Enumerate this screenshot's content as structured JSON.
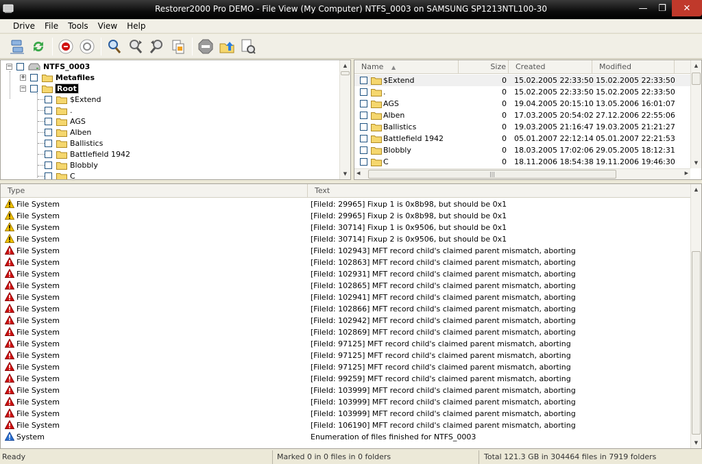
{
  "window": {
    "title": "Restorer2000 Pro DEMO - File View (My Computer) NTFS_0003 on SAMSUNG SP1213NTL100-30",
    "minimize_glyph": "—",
    "maximize_glyph": "❐",
    "close_glyph": "✕"
  },
  "menu": [
    "Drive",
    "File",
    "Tools",
    "View",
    "Help"
  ],
  "toolbar": {
    "icons": [
      "network-drives-icon",
      "refresh-icon",
      "record-icon",
      "zoom-target-icon",
      "search-icon",
      "find-next-icon",
      "find-previous-icon",
      "copy-files-icon",
      "stop-icon",
      "up-folder-icon",
      "properties-icon"
    ]
  },
  "tree": {
    "root": "NTFS_0003",
    "metafiles": "Metafiles",
    "root_folder": "Root",
    "children": [
      "$Extend",
      ".",
      "AGS",
      "Alben",
      "Ballistics",
      "Battlefield 1942",
      "Blobbly",
      "C"
    ],
    "expand_glyph": "+",
    "collapse_glyph": "−"
  },
  "file_list": {
    "columns": [
      "Name",
      "Size",
      "Created",
      "Modified"
    ],
    "sort_glyph": "▲",
    "rows": [
      {
        "name": "$Extend",
        "size": "0",
        "created": "15.02.2005 22:33:50",
        "modified": "15.02.2005 22:33:50"
      },
      {
        "name": ".",
        "size": "0",
        "created": "15.02.2005 22:33:50",
        "modified": "15.02.2005 22:33:50"
      },
      {
        "name": "AGS",
        "size": "0",
        "created": "19.04.2005 20:15:10",
        "modified": "13.05.2006 16:01:07"
      },
      {
        "name": "Alben",
        "size": "0",
        "created": "17.03.2005 20:54:02",
        "modified": "27.12.2006 22:55:06"
      },
      {
        "name": "Ballistics",
        "size": "0",
        "created": "19.03.2005 21:16:47",
        "modified": "19.03.2005 21:21:27"
      },
      {
        "name": "Battlefield 1942",
        "size": "0",
        "created": "05.01.2007 22:12:14",
        "modified": "05.01.2007 22:21:53"
      },
      {
        "name": "Blobbly",
        "size": "0",
        "created": "18.03.2005 17:02:06",
        "modified": "29.05.2005 18:12:31"
      },
      {
        "name": "C",
        "size": "0",
        "created": "18.11.2006 18:54:38",
        "modified": "19.11.2006 19:46:30"
      }
    ]
  },
  "log": {
    "columns": [
      "Type",
      "Text"
    ],
    "rows": [
      {
        "level": "warning",
        "type": "File System",
        "text": "[FileId: 29965] Fixup 1 is 0x8b98, but should be 0x1"
      },
      {
        "level": "warning",
        "type": "File System",
        "text": "[FileId: 29965] Fixup 2 is 0x8b98, but should be 0x1"
      },
      {
        "level": "warning",
        "type": "File System",
        "text": "[FileId: 30714] Fixup 1 is 0x9506, but should be 0x1"
      },
      {
        "level": "warning",
        "type": "File System",
        "text": "[FileId: 30714] Fixup 2 is 0x9506, but should be 0x1"
      },
      {
        "level": "error",
        "type": "File System",
        "text": "[FileId: 102943] MFT record child's claimed parent mismatch, aborting"
      },
      {
        "level": "error",
        "type": "File System",
        "text": "[FileId: 102863] MFT record child's claimed parent mismatch, aborting"
      },
      {
        "level": "error",
        "type": "File System",
        "text": "[FileId: 102931] MFT record child's claimed parent mismatch, aborting"
      },
      {
        "level": "error",
        "type": "File System",
        "text": "[FileId: 102865] MFT record child's claimed parent mismatch, aborting"
      },
      {
        "level": "error",
        "type": "File System",
        "text": "[FileId: 102941] MFT record child's claimed parent mismatch, aborting"
      },
      {
        "level": "error",
        "type": "File System",
        "text": "[FileId: 102866] MFT record child's claimed parent mismatch, aborting"
      },
      {
        "level": "error",
        "type": "File System",
        "text": "[FileId: 102942] MFT record child's claimed parent mismatch, aborting"
      },
      {
        "level": "error",
        "type": "File System",
        "text": "[FileId: 102869] MFT record child's claimed parent mismatch, aborting"
      },
      {
        "level": "error",
        "type": "File System",
        "text": "[FileId: 97125] MFT record child's claimed parent mismatch, aborting"
      },
      {
        "level": "error",
        "type": "File System",
        "text": "[FileId: 97125] MFT record child's claimed parent mismatch, aborting"
      },
      {
        "level": "error",
        "type": "File System",
        "text": "[FileId: 97125] MFT record child's claimed parent mismatch, aborting"
      },
      {
        "level": "error",
        "type": "File System",
        "text": "[FileId: 99259] MFT record child's claimed parent mismatch, aborting"
      },
      {
        "level": "error",
        "type": "File System",
        "text": "[FileId: 103999] MFT record child's claimed parent mismatch, aborting"
      },
      {
        "level": "error",
        "type": "File System",
        "text": "[FileId: 103999] MFT record child's claimed parent mismatch, aborting"
      },
      {
        "level": "error",
        "type": "File System",
        "text": "[FileId: 103999] MFT record child's claimed parent mismatch, aborting"
      },
      {
        "level": "error",
        "type": "File System",
        "text": "[FileId: 106190] MFT record child's claimed parent mismatch, aborting"
      },
      {
        "level": "info",
        "type": "System",
        "text": "Enumeration of files finished for NTFS_0003"
      }
    ]
  },
  "status": {
    "state": "Ready",
    "marked": "Marked 0 in 0 files in 0 folders",
    "total": "Total 121.3 GB in 304464 files in 7919 folders"
  },
  "colors": {
    "error": "#d01010",
    "warning": "#f2c200",
    "info": "#2a6fd0",
    "folder": "#f5d76e",
    "titlebar": "#000000"
  }
}
